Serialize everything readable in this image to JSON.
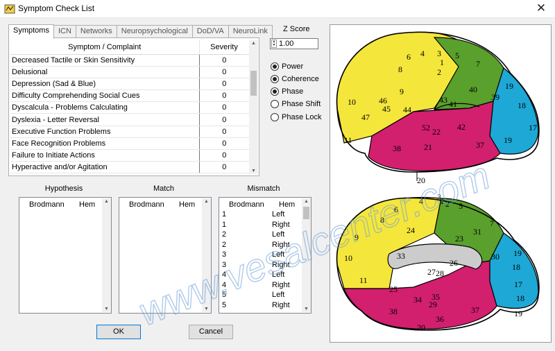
{
  "window": {
    "title": "Symptom Check List",
    "close_glyph": "✕"
  },
  "tabs": [
    "Symptoms",
    "ICN",
    "Networks",
    "Neuropsychological",
    "DoD/VA",
    "NeuroLink"
  ],
  "symptoms": {
    "headers": {
      "complaint": "Symptom / Complaint",
      "severity": "Severity"
    },
    "rows": [
      {
        "complaint": "Decreased Tactile or Skin Sensitivity",
        "severity": "0"
      },
      {
        "complaint": "Delusional",
        "severity": "0"
      },
      {
        "complaint": "Depression (Sad & Blue)",
        "severity": "0"
      },
      {
        "complaint": "Difficulty Comprehending Social Cues",
        "severity": "0"
      },
      {
        "complaint": "Dyscalcula - Problems Calculating",
        "severity": "0"
      },
      {
        "complaint": "Dyslexia - Letter Reversal",
        "severity": "0"
      },
      {
        "complaint": "Executive Function Problems",
        "severity": "0"
      },
      {
        "complaint": "Face Recognition Problems",
        "severity": "0"
      },
      {
        "complaint": "Failure to Initiate Actions",
        "severity": "0"
      },
      {
        "complaint": "Hyperactive and/or Agitation",
        "severity": "0"
      }
    ]
  },
  "zscore": {
    "label": "Z Score",
    "value": "1.00"
  },
  "radios": [
    {
      "label": "Power",
      "checked": true
    },
    {
      "label": "Coherence",
      "checked": true
    },
    {
      "label": "Phase",
      "checked": true
    },
    {
      "label": "Phase Shift",
      "checked": false
    },
    {
      "label": "Phase Lock",
      "checked": false
    }
  ],
  "groups": {
    "hypothesis": {
      "title": "Hypothesis",
      "col1": "Brodmann",
      "col2": "Hem"
    },
    "match": {
      "title": "Match",
      "col1": "Brodmann",
      "col2": "Hem"
    },
    "mismatch": {
      "title": "Mismatch",
      "col1": "Brodmann",
      "col2": "Hem",
      "rows": [
        {
          "area": "1",
          "hem": "Left"
        },
        {
          "area": "1",
          "hem": "Right"
        },
        {
          "area": "2",
          "hem": "Left"
        },
        {
          "area": "2",
          "hem": "Right"
        },
        {
          "area": "3",
          "hem": "Left"
        },
        {
          "area": "3",
          "hem": "Right"
        },
        {
          "area": "4",
          "hem": "Left"
        },
        {
          "area": "4",
          "hem": "Right"
        },
        {
          "area": "5",
          "hem": "Left"
        },
        {
          "area": "5",
          "hem": "Right"
        }
      ]
    }
  },
  "buttons": {
    "ok": "OK",
    "cancel": "Cancel"
  },
  "brain": {
    "lateral_labels": [
      "1",
      "2",
      "3",
      "4",
      "5",
      "6",
      "7",
      "8",
      "9",
      "10",
      "11",
      "18",
      "19",
      "19",
      "17",
      "20",
      "21",
      "22",
      "37",
      "38",
      "39",
      "40",
      "41",
      "42",
      "43",
      "44",
      "45",
      "46",
      "47",
      "52"
    ],
    "medial_labels": [
      "1",
      "2",
      "3",
      "4",
      "5",
      "6",
      "7",
      "8",
      "9",
      "10",
      "11",
      "17",
      "18",
      "18",
      "19",
      "19",
      "20",
      "23",
      "24",
      "25",
      "26",
      "27",
      "28",
      "29",
      "30",
      "31",
      "33",
      "34",
      "35",
      "36",
      "37",
      "38"
    ],
    "colors": {
      "frontal": "#f5e63c",
      "parietal": "#5aa02c",
      "occipital": "#1ea8d6",
      "temporal": "#d21f6e",
      "corpus": "#cccccc"
    }
  },
  "watermark": "www.vesalcenter.com"
}
